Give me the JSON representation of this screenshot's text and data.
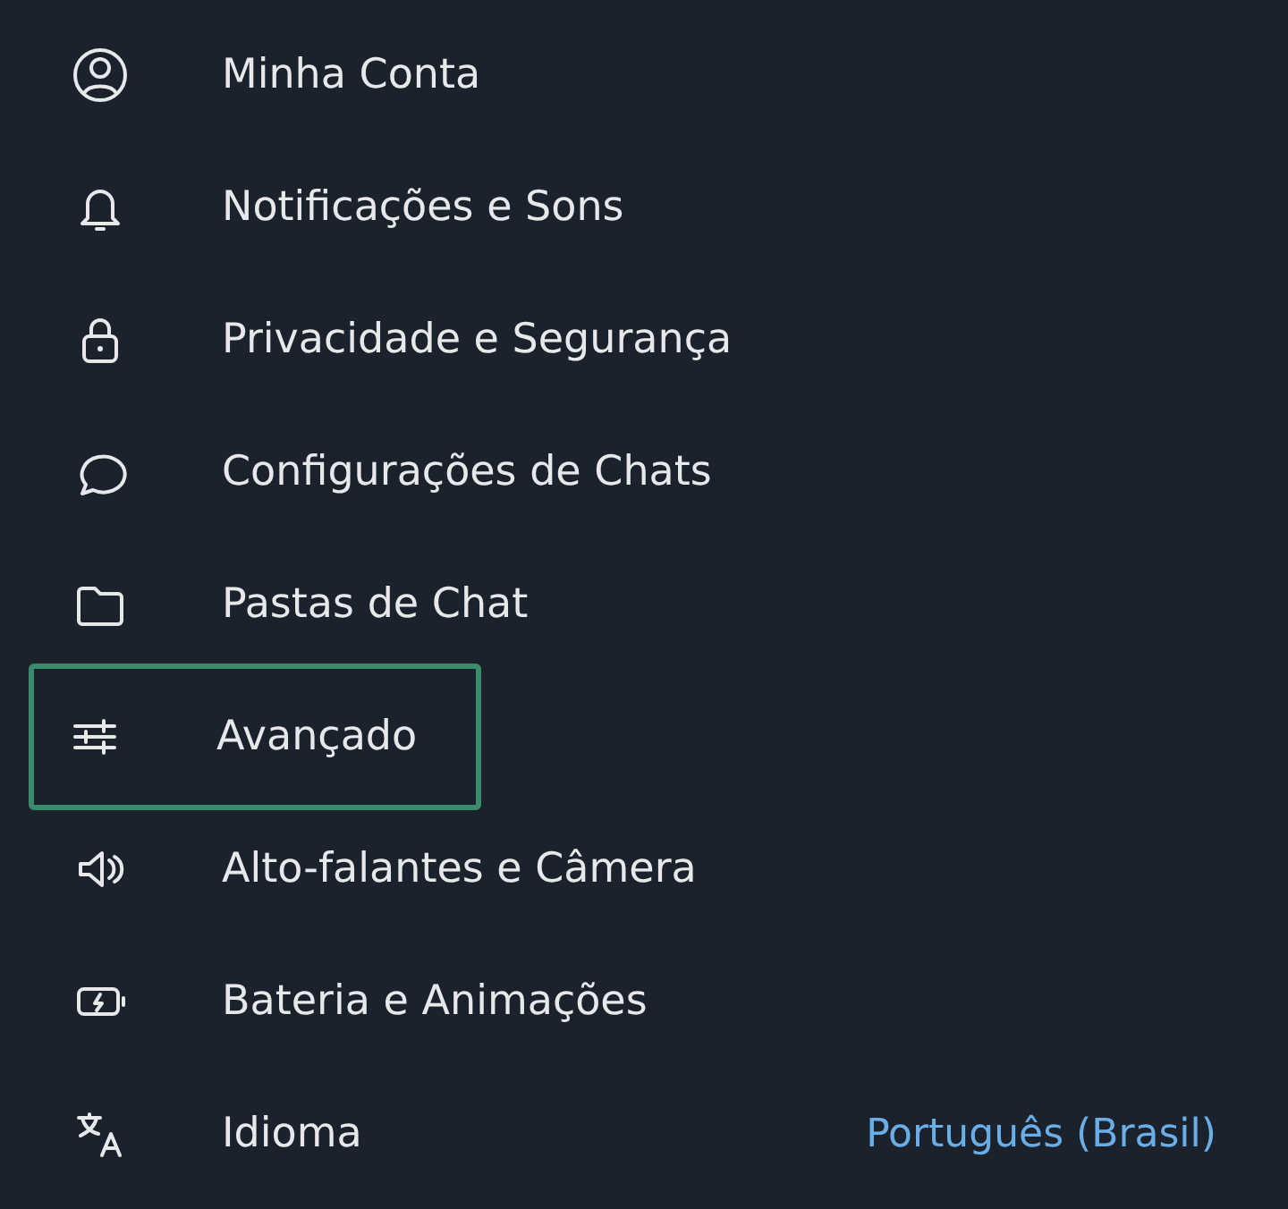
{
  "menu": [
    {
      "kind": "account",
      "label": "Minha Conta",
      "focused": false
    },
    {
      "kind": "bell",
      "label": "Notificações e Sons",
      "focused": false
    },
    {
      "kind": "lock",
      "label": "Privacidade e Segurança",
      "focused": false
    },
    {
      "kind": "chat",
      "label": "Configurações de Chats",
      "focused": false
    },
    {
      "kind": "folder",
      "label": "Pastas de Chat",
      "focused": false
    },
    {
      "kind": "sliders",
      "label": "Avançado",
      "focused": true
    },
    {
      "kind": "speaker",
      "label": "Alto-falantes e Câmera",
      "focused": false
    },
    {
      "kind": "battery",
      "label": "Bateria e Animações",
      "focused": false
    },
    {
      "kind": "translate",
      "label": "Idioma",
      "focused": false,
      "value": "Português (Brasil)"
    }
  ]
}
